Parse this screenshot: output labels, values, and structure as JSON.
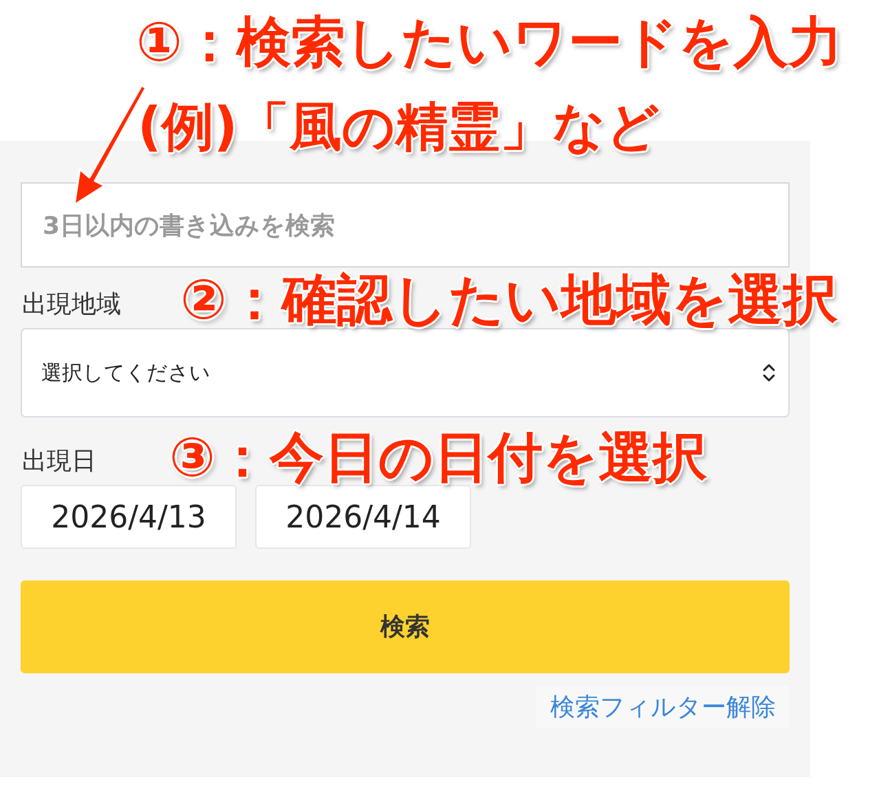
{
  "annotations": [
    {
      "text": "①：検索したいワードを入力"
    },
    {
      "text": "(例)「風の精霊」など"
    },
    {
      "text": "②：確認したい地域を選択"
    },
    {
      "text": "③：今日の日付を選択"
    }
  ],
  "search": {
    "placeholder": "3日以内の書き込みを検索"
  },
  "region": {
    "label": "出現地域",
    "value": "選択してください"
  },
  "date": {
    "label": "出現日",
    "from": "2026/4/13",
    "to": "2026/4/14"
  },
  "search_button": "検索",
  "clear_link": "検索フィルター解除"
}
